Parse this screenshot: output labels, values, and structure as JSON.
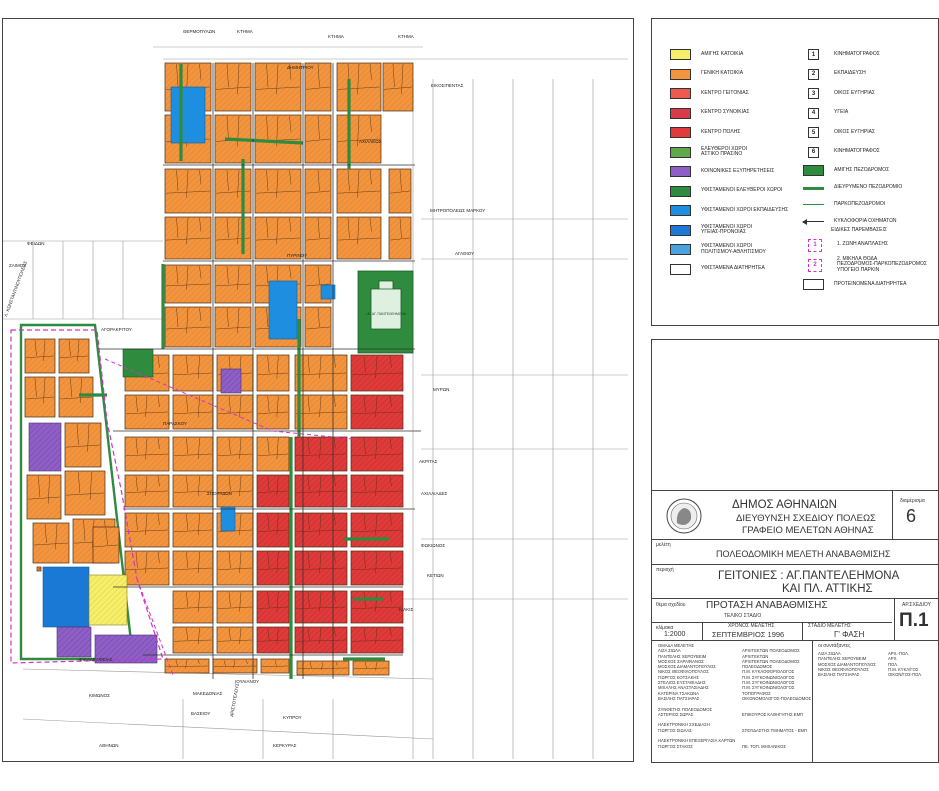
{
  "map": {
    "streets": {
      "ktima_1": "ΚΤΗΜΑ",
      "ktima_2": "ΚΤΗΜΑ",
      "ktima_3": "ΚΤΗΜΑ",
      "thermopylon": "ΘΕΡΜΟΠΥΛΩΝ",
      "dimitriou": "ΔΗΜΗΤΡΙΟΥ",
      "eikosipentas": "ΕΙΚΟΣΙΠΕΝΤΑΣ",
      "ahilleos": "ΑΧΙΛΛΕΩΣ",
      "mitropoleos": "ΜΗΤΡΟΠΟΛΕΩΣ ΜΑΡΚΟΥ",
      "agathiou": "ΑΓΑΘΙΟΥ",
      "feidon": "ΦΕΙΔΩΝ",
      "zaimou": "ΖΑΙΜΟΥ",
      "konstantinoupoleos": "Λ. ΚΩΝΣΤΑΝΤΙΝΟΥΠΟΛΕΩΣ",
      "agoras": "ΑΓΟΡΑΚΡΙΤΟΥ",
      "pirinou": "ΠΥΡΙΝΟΥ",
      "paraskou": "ΠΑΡΑΣΚΟΥ",
      "myron": "ΜΥΡΩΝ",
      "akritas": "ΑΚΡΙΤΑΣ",
      "ahiliades": "ΑΧΙΛΛΙΑΔΕΣ",
      "sporadon": "ΣΠΟΡΑΔΩΝ",
      "fokionos": "ΦΩΚΙΩΝΟΣ",
      "ketion": "ΚΕΤΙΩΝ",
      "kilkis": "ΚΙΛΚΙΣ",
      "filadelfias": "ΦΙΛΑΔΕΛΦΕΙΑΣ",
      "iouliani": "ΙΟΥΛΙΑΝΟΥ",
      "kimonos": "ΚΙΜΩΝΟΣ",
      "vaseiou": "ΒΑΣΕΙΟΥ",
      "makedonias": "ΜΑΚΕΔΟΝΙΑΣ",
      "aristotelous": "ΑΡΙΣΤΟΤΕΛΟΥΣ",
      "kyprou": "ΚΥΠΡΟΥ",
      "kerkyras": "ΚΕΡΚΥΡΑΣ",
      "athinon": "ΑΘΗΝΩΝ"
    },
    "church_label": "Ι.Ν. ΑΓ. ΠΑΝΤΕΛΕΗΜΟΝΑ"
  },
  "legend": {
    "zones": [
      {
        "label": "ΑΜΙΓΗΣ ΚΑΤΟΙΚΙΑ",
        "color": "#f7ee6a"
      },
      {
        "label": "ΓΕΝΙΚΗ ΚΑΤΟΙΚΙΑ",
        "color": "#f3953e"
      },
      {
        "label": "ΚΕΝΤΡΟ ΓΕΙΤΟΝΙΑΣ",
        "color": "#ec5b4e"
      },
      {
        "label": "ΚΕΝΤΡΟ ΣΥΝΟΙΚΙΑΣ",
        "color": "#d93a4c"
      },
      {
        "label": "ΚΕΝΤΡΟ ΠΟΛΗΣ",
        "color": "#e03a3a"
      },
      {
        "label": "ΕΛΕΥΘΕΡΟΙ ΧΩΡΟΙ\nΑΣΤΙΚΟ ΠΡΑΣΙΝΟ",
        "color": "#61a84c"
      },
      {
        "label": "ΚΟΙΝΩΝΙΚΕΣ ΕΞΥΠΗΡΕΤΗΣΕΙΣ",
        "color": "#8e5fc6"
      },
      {
        "label": "ΥΦΙΣΤΑΜΕΝΟΙ ΕΛΕΥΘΕΡΟΙ ΧΩΡΟΙ",
        "color": "#2f8b3e"
      },
      {
        "label": "ΥΦΙΣΤΑΜΕΝΟΙ ΧΩΡΟΙ ΕΚΠΑΙΔΕΥΣΗΣ",
        "color": "#1e8ee0"
      },
      {
        "label": "ΥΦΙΣΤΑΜΕΝΟΙ ΧΩΡΟΙ\nΥΓΕΙΑΣ-ΠΡΟΝΟΙΑΣ",
        "color": "#1b79d6"
      },
      {
        "label": "ΥΦΙΣΤΑΜΕΝΟΙ ΧΩΡΟΙ\nΠΟΛΙΤΙΣΜΟΥ-ΑΘΛΗΤΙΣΜΟΥ",
        "color": "#4aa3e0"
      },
      {
        "label": "ΥΦΙΣΤΑΜΕΝΑ ΔΙΑΤΗΡΗΤΕΑ",
        "color": "#ffffff"
      }
    ],
    "numbered": [
      {
        "num": "1",
        "label": "ΚΙΝΗΜΑΤΟΓΡΑΦΟΣ"
      },
      {
        "num": "2",
        "label": "ΕΚΠΑΙΔΕΥΣΗ"
      },
      {
        "num": "3",
        "label": "ΟΙΚΟΣ ΕΥΓΗΡΙΑΣ"
      },
      {
        "num": "4",
        "label": "ΥΓΕΙΑ"
      },
      {
        "num": "5",
        "label": "ΟΙΚΟΣ ΕΥΓΗΡΙΑΣ"
      },
      {
        "num": "6",
        "label": "ΚΙΝΗΜΑΤΟΓΡΑΦΟΣ"
      }
    ],
    "symbols": [
      {
        "label": "ΑΜΙΓΗΣ ΠΕΖΟΔΡΟΜΟΣ"
      },
      {
        "label": "ΔΙΕΥΡΥΜΕΝΟ ΠΕΖΟΔΡΟΜΙΟ"
      },
      {
        "label": "ΠΑΡΚΟΠΕΖΟΔΡΟΜΟΙ"
      },
      {
        "label": "ΚΥΚΛΟΦΟΡΙΑ ΟΧΗΜΑΤΩΝ"
      }
    ],
    "special_heading": "ΕΙΔΙΚΕΣ ΠΑΡΕΜΒΑΣΕΙΣ",
    "special": [
      {
        "num": "1",
        "label": "1. ΖΩΝΗ ΑΝΑΠΛΑΣΗΣ"
      },
      {
        "num": "2",
        "label": "2. ΜΙΚΗΛΑ ΘΟΔΑ\nΠΕΖΟΔΡΟΜΟΣ-ΠΑΡΚΟΠΕΖΟΔΡΟΜΟΣ\nΥΠΟΓΕΙΟ ΠΑΡΚΙΝ"
      }
    ],
    "proposed": "ΠΡΟΤΕΙΝΟΜΕΝΑ ΔΙΑΤΗΡΗΤΕΑ"
  },
  "titleblock": {
    "org_line1": "ΔΗΜΟΣ ΑΘΗΝΑΙΩΝ",
    "org_line2": "ΔΙΕΥΘΥΝΣΗ ΣΧΕΔΙΟΥ ΠΟΛΕΩΣ",
    "org_line3": "ΓΡΑΦΕΙΟ ΜΕΛΕΤΩΝ ΑΘΗΝΑΣ",
    "district_label": "διαμέρισμα",
    "district_num": "6",
    "study_label": "μελέτη",
    "study_title": "ΠΟΛΕΟΔΟΜΙΚΗ ΜΕΛΕΤΗ ΑΝΑΒΑΘΜΙΣΗΣ",
    "area_label": "περιοχή",
    "area_line1": "ΓΕΙΤΟΝΙΕΣ : ΑΓ.ΠΑΝΤΕΛΕΗΜΟΝΑ",
    "area_line2": "ΚΑΙ ΠΛ. ΑΤΤΙΚΗΣ",
    "drawing_label": "θέμα σχεδίου",
    "drawing_title": "ΠΡΟΤΑΣΗ ΑΝΑΒΑΘΜΙΣΗΣ",
    "drawing_sub": "ΤΕΛΙΚΟ ΣΤΑΔΙΟ",
    "sheet_label": "ΑΡ.ΣΧΕΔΙΟΥ",
    "sheet_num": "Π.1",
    "scale_label": "κλίμακα",
    "scale": "1:2000",
    "time_label": "ΧΡΟΝΟΣ ΜΕΛΕΤΗΣ",
    "time": "ΣΕΠΤΕΜΒΡΙΟΣ 1996",
    "stage_label": "ΣΤΑΔΙΟ ΜΕΛΕΤΗΣ",
    "stage": "Γ' ΦΑΣΗ",
    "team_left": "ΟΜΑΔΑ ΜΕΛΕΤΗΣ\nΛΙΖΑ ΣΙΩΛΑ\nΠΑΝΤΕΛΗΣ ΧΕΡΟΥΒΕΙΜ\nΜΟΣΧΟΣ ΣΑΡΑΦΙΑΝΟΣ\nΜΟΣΧΟΣ ΔΙΑΜΑΝΤΟΠΟΥΛΟΣ\nΝΙΚΟΣ ΘΕΟΦΙΛΟΠΟΥΛΟΣ\nΓΙΩΡΓΟΣ ΚΟΤΣΑΚΗΣ\nΣΤΕΛΙΟΣ ΕΥΣΤΑΘΙΑΔΗΣ\nΜΙΧΑΛΗΣ ΑΝΑΣΤΑΣΙΑΔΗΣ\nΚΑΤΕΡΙΝΑ ΤΣΑΚΩΝΑ\nΒΑΣΙΛΗΣ ΠΑΤΣΙΑΡΑΣ\n\nΣΥΝΘΕΤΗΣ ΠΟΛΕΟΔΟΜΟΣ\nΑΣΤΕΡΙΟΣ ΣΩΡΑΣ\n\nΗΛΕΚΤΡΟΝΙΚΗ ΣΧΕΔΙΑΣΗ\nΓΙΩΡΓΟΣ ΣΙΩΛΑΣ\n\nΗΛΕΚΤΡΟΝΙΚΗ ΕΠΕΞΕΡΓΑΣΙΑ ΧΑΡΤΩΝ\nΓΙΩΡΓΟΣ ΣΤΑΚΟΣ",
    "team_mid": "\nΑΡΧΙΤΕΚΤΩΝ ΠΟΛΕΟΔΟΜΟΣ\nΑΡΧΙΤΕΚΤΩΝ\nΑΡΧΙΤΕΚΤΩΝ ΠΟΛΕΟΔΟΜΟΣ\nΠΟΛΕΟΔΟΜΟΣ\nΠ.Μ. ΚΥΚΛΟΦΟΡΙΟΛΟΓΟΣ\nΠ.Μ. ΣΥΓΚΟΙΝΩΝΙΟΛΟΓΟΣ\nΠ.Μ. ΣΥΓΚΟΙΝΩΝΙΟΛΟΓΟΣ\nΠ.Μ. ΣΥΓΚΟΙΝΩΝΙΟΛΟΓΟΣ\nΤΟΠΟΓΡΑΦΟΣ\nΟΙΚΟΝΟΜΟΛΟΓΟΣ-ΠΟΛΕΟΔΟΜΟΣ\n\n\nΕΠΙΚΟΥΡΟΣ ΚΑΘΗΓΗΤΗΣ ΕΜΠ\n\n\nΣΠΟΥΔΑΣΤΗΣ ΤΜΗΜΑΤΟΣ - ΕΜΠ\n\n\nΠΕ. ΤΟΠ. ΜΗΧΑΝΙΚΟΣ",
    "signers_label": "οι συντάξαντες",
    "signers": "ΛΙΖΑ ΣΙΩΛΑ\nΠΑΝΤΕΛΗΣ ΧΕΡΟΥΒΕΙΜ\nΜΟΣΧΟΣ ΔΙΑΜΑΝΤΟΠΟΥΛΟΣ\nΝΙΚΟΣ ΘΕΟΦΙΛΟΠΟΥΛΟΣ\nΒΑΣΙΛΗΣ ΠΑΤΣΙΑΡΑΣ",
    "signers_roles": "ΑΡΧ.-ΠΟΛ.\nΑΡΧ.\nΠΟΛ.\nΠ.Μ. ΚΥΚΛ/ΓΟΣ\nΟΙΚΟΝ/ΓΟΣ-ΠΟΛ."
  },
  "colors": {
    "residential": "#f3953e",
    "pure_residential": "#f7ee6a",
    "commercial": "#e03a3a",
    "green": "#2f8b3e",
    "light_green": "#61a84c",
    "school": "#1e8ee0",
    "social": "#8e5fc6",
    "magenta_boundary": "#d531c8"
  }
}
